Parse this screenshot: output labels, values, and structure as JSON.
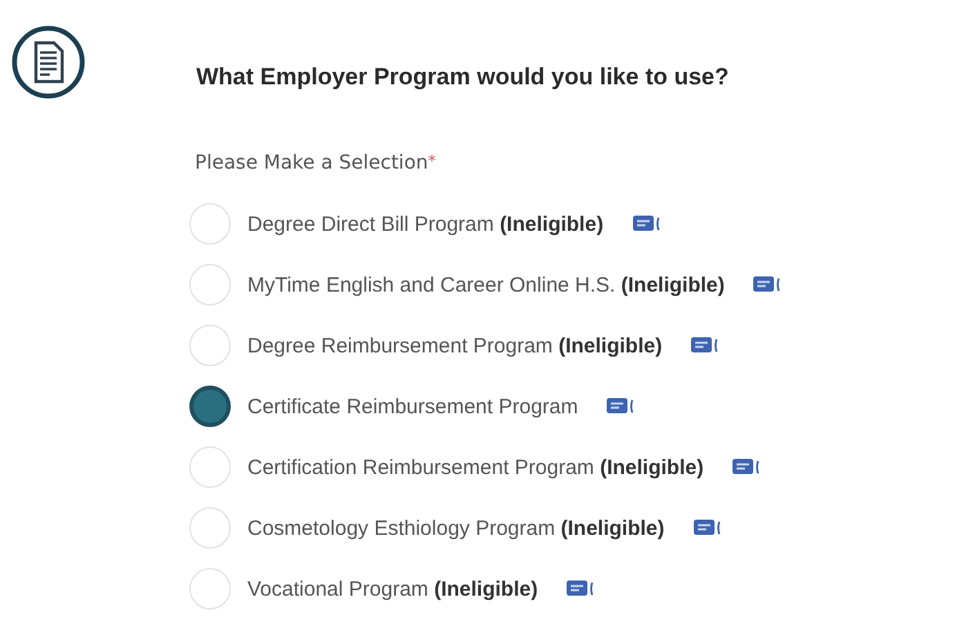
{
  "question": {
    "title": "What Employer Program would you like to use?"
  },
  "selection": {
    "label": "Please Make a Selection",
    "required_mark": "*"
  },
  "options": [
    {
      "label": "Degree Direct Bill Program **(Ineligible)**",
      "selected": false
    },
    {
      "label": "MyTime English and Career Online H.S. **(Ineligible)**",
      "selected": false
    },
    {
      "label": "Degree Reimbursement Program **(Ineligible)**",
      "selected": false
    },
    {
      "label": "Certificate Reimbursement Program",
      "selected": true
    },
    {
      "label": "Certification Reimbursement Program **(Ineligible)**",
      "selected": false
    },
    {
      "label": "Cosmetology Esthiology Program **(Ineligible)**",
      "selected": false
    },
    {
      "label": "Vocational Program **(Ineligible)**",
      "selected": false
    }
  ]
}
